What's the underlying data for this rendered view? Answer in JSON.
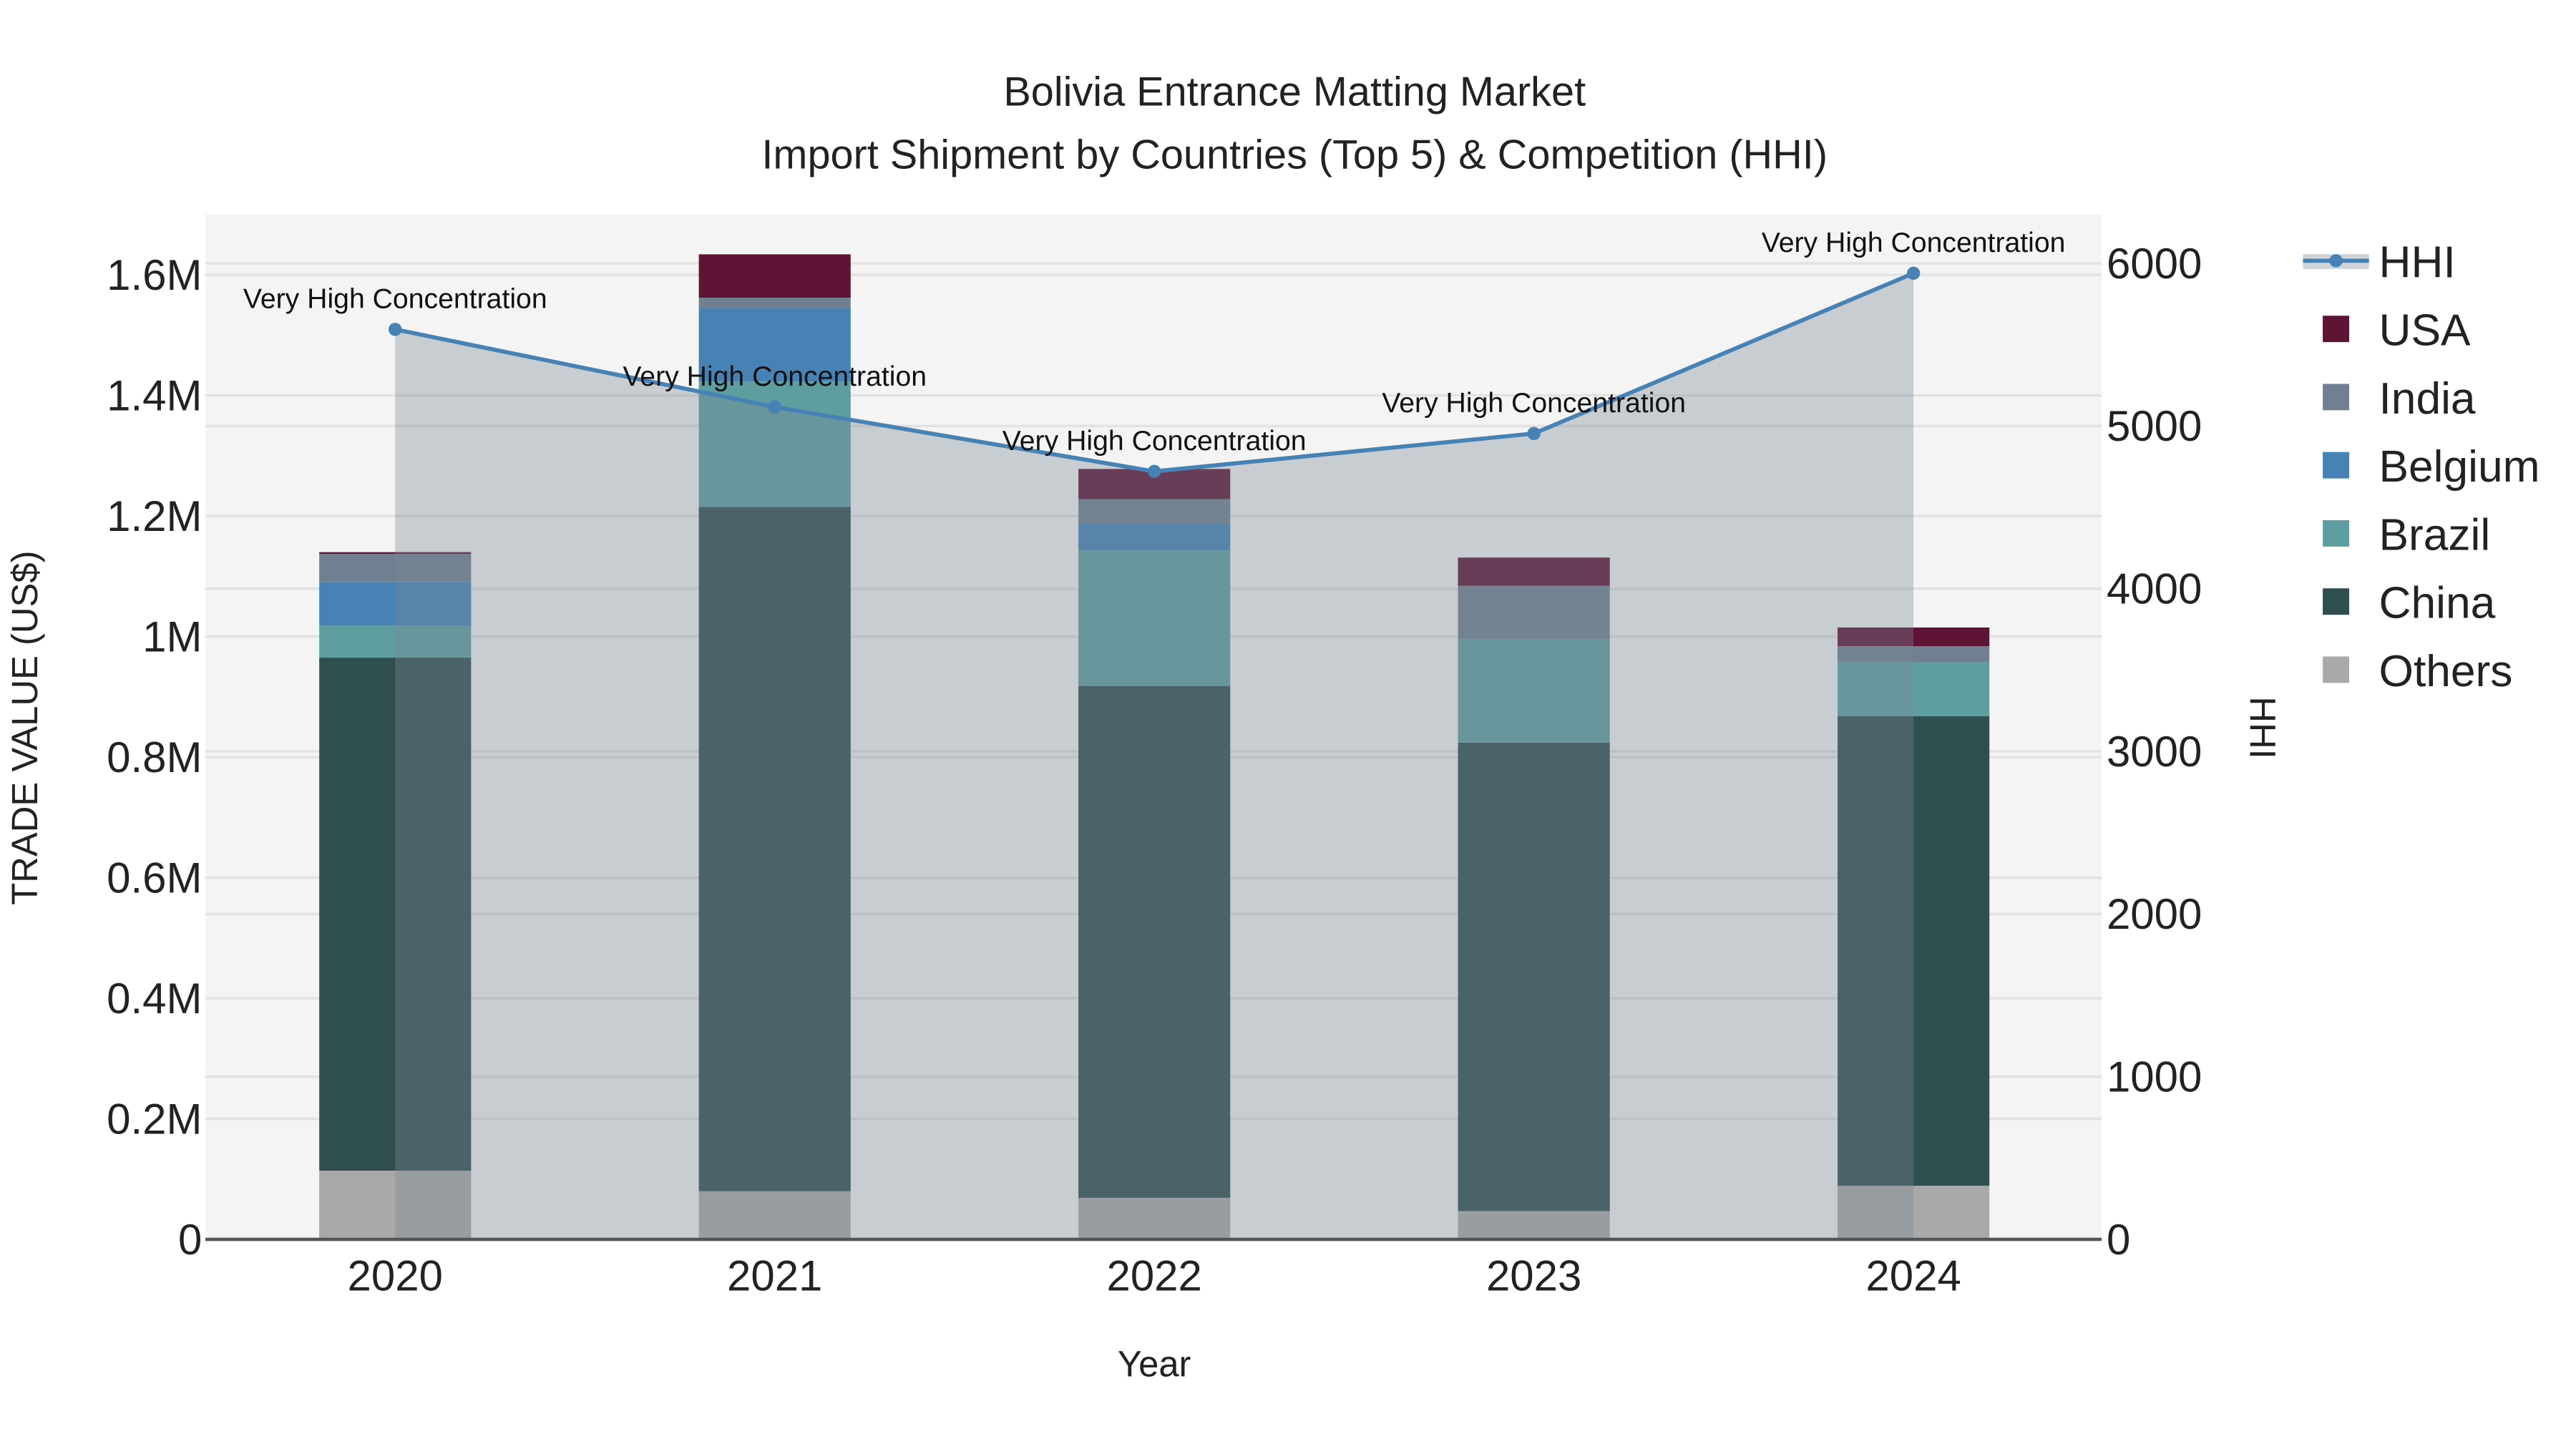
{
  "chart_data": {
    "type": "bar",
    "title": "Bolivia Entrance Matting Market",
    "subtitle": "Import Shipment by Countries (Top 5) & Competition (HHI)",
    "xlabel": "Year",
    "ylabel": "TRADE VALUE (US$)",
    "y2label": "HHI",
    "categories": [
      "2020",
      "2021",
      "2022",
      "2023",
      "2024"
    ],
    "ylim": [
      0,
      1700000
    ],
    "y2lim": [
      0,
      6300
    ],
    "yticks": [
      0,
      200000,
      400000,
      600000,
      800000,
      1000000,
      1200000,
      1400000,
      1600000
    ],
    "ytick_labels": [
      "0",
      "0.2M",
      "0.4M",
      "0.6M",
      "0.8M",
      "1M",
      "1.2M",
      "1.4M",
      "1.6M"
    ],
    "y2ticks": [
      0,
      1000,
      2000,
      3000,
      4000,
      5000,
      6000
    ],
    "y2tick_labels": [
      "0",
      "1000",
      "2000",
      "3000",
      "4000",
      "5000",
      "6000"
    ],
    "series": [
      {
        "name": "Others",
        "color": "#a9a9a9",
        "values": [
          114000,
          80000,
          69000,
          47000,
          89000
        ]
      },
      {
        "name": "China",
        "color": "#2f4f4f",
        "values": [
          851000,
          1135000,
          849000,
          777000,
          779000
        ]
      },
      {
        "name": "Brazil",
        "color": "#5f9ea0",
        "values": [
          53000,
          208000,
          225000,
          172000,
          89000
        ]
      },
      {
        "name": "Belgium",
        "color": "#4682b4",
        "values": [
          72000,
          122000,
          44000,
          0,
          0
        ]
      },
      {
        "name": "India",
        "color": "#708090",
        "values": [
          47000,
          17000,
          41000,
          88000,
          27000
        ]
      },
      {
        "name": "USA",
        "color": "#5f1435",
        "values": [
          3000,
          72000,
          50000,
          47000,
          31000
        ]
      }
    ],
    "hhi": {
      "name": "HHI",
      "color": "#4682b4",
      "values": [
        5594,
        5117,
        4721,
        4954,
        5939
      ],
      "annotations": [
        "Very High Concentration",
        "Very High Concentration",
        "Very High Concentration",
        "Very High Concentration",
        "Very High Concentration"
      ]
    },
    "legend": [
      "HHI",
      "USA",
      "India",
      "Belgium",
      "Brazil",
      "China",
      "Others"
    ],
    "legend_placement": "right",
    "grid": true
  }
}
